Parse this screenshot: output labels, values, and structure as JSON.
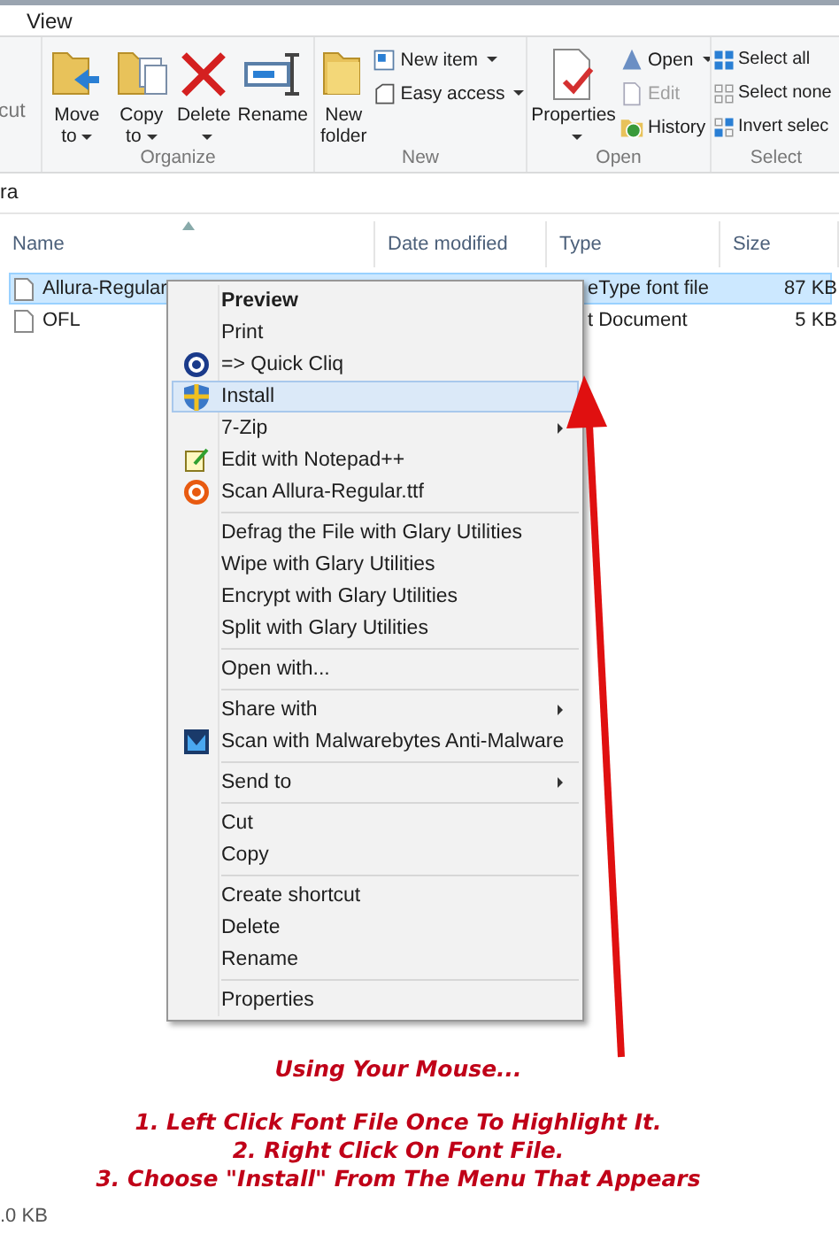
{
  "ribbon": {
    "tab": "View",
    "clipboard_fragment": "cut",
    "groups": [
      {
        "label": "Organize",
        "buttons": [
          {
            "kind": "large",
            "label": "Move to",
            "dropdown": true,
            "disabled": false
          },
          {
            "kind": "large",
            "label": "Copy to",
            "dropdown": true,
            "disabled": false
          },
          {
            "kind": "large",
            "label": "Delete",
            "dropdown": true,
            "disabled": false
          },
          {
            "kind": "large",
            "label": "Rename",
            "dropdown": false,
            "disabled": false
          }
        ]
      },
      {
        "label": "New",
        "buttons": [
          {
            "kind": "large",
            "label": "New folder",
            "dropdown": false,
            "disabled": false
          },
          {
            "kind": "small",
            "label": "New item",
            "dropdown": true,
            "disabled": false
          },
          {
            "kind": "small",
            "label": "Easy access",
            "dropdown": true,
            "disabled": false
          }
        ]
      },
      {
        "label": "Open",
        "buttons": [
          {
            "kind": "large",
            "label": "Properties",
            "dropdown": true,
            "disabled": false
          },
          {
            "kind": "small",
            "label": "Open",
            "dropdown": true,
            "disabled": false
          },
          {
            "kind": "small",
            "label": "Edit",
            "dropdown": false,
            "disabled": true
          },
          {
            "kind": "small",
            "label": "History",
            "dropdown": false,
            "disabled": false
          }
        ]
      },
      {
        "label": "Select",
        "buttons": [
          {
            "kind": "small",
            "label": "Select all",
            "dropdown": false,
            "disabled": false
          },
          {
            "kind": "small",
            "label": "Select none",
            "dropdown": false,
            "disabled": false
          },
          {
            "kind": "small",
            "label": "Invert selec",
            "dropdown": false,
            "disabled": false
          }
        ]
      }
    ]
  },
  "address": "ra",
  "table": {
    "columns": [
      "Name",
      "Date modified",
      "Type",
      "Size"
    ],
    "rows": [
      {
        "name": "Allura-Regular",
        "type": "eType font file",
        "size": "87 KB",
        "selected": true
      },
      {
        "name": "OFL",
        "type": "t Document",
        "size": "5 KB",
        "selected": false
      }
    ]
  },
  "context_menu": {
    "sections": [
      [
        {
          "label": "Preview",
          "bold": true,
          "submenu": false,
          "selected": false
        },
        {
          "label": "Print",
          "bold": false,
          "submenu": false,
          "selected": false
        },
        {
          "label": "=> Quick Cliq",
          "bold": false,
          "submenu": false,
          "selected": false
        },
        {
          "label": "Install",
          "bold": false,
          "submenu": false,
          "selected": true
        },
        {
          "label": "7-Zip",
          "bold": false,
          "submenu": true,
          "selected": false
        },
        {
          "label": "Edit with Notepad++",
          "bold": false,
          "submenu": false,
          "selected": false
        },
        {
          "label": "Scan Allura-Regular.ttf",
          "bold": false,
          "submenu": false,
          "selected": false
        }
      ],
      [
        {
          "label": "Defrag the File with Glary Utilities",
          "bold": false,
          "submenu": false,
          "selected": false
        },
        {
          "label": "Wipe with Glary Utilities",
          "bold": false,
          "submenu": false,
          "selected": false
        },
        {
          "label": "Encrypt with Glary Utilities",
          "bold": false,
          "submenu": false,
          "selected": false
        },
        {
          "label": "Split with Glary Utilities",
          "bold": false,
          "submenu": false,
          "selected": false
        }
      ],
      [
        {
          "label": "Open with...",
          "bold": false,
          "submenu": false,
          "selected": false
        }
      ],
      [
        {
          "label": "Share with",
          "bold": false,
          "submenu": true,
          "selected": false
        },
        {
          "label": "Scan with Malwarebytes Anti-Malware",
          "bold": false,
          "submenu": false,
          "selected": false
        }
      ],
      [
        {
          "label": "Send to",
          "bold": false,
          "submenu": true,
          "selected": false
        }
      ],
      [
        {
          "label": "Cut",
          "bold": false,
          "submenu": false,
          "selected": false
        },
        {
          "label": "Copy",
          "bold": false,
          "submenu": false,
          "selected": false
        }
      ],
      [
        {
          "label": "Create shortcut",
          "bold": false,
          "submenu": false,
          "selected": false
        },
        {
          "label": "Delete",
          "bold": false,
          "submenu": false,
          "selected": false
        },
        {
          "label": "Rename",
          "bold": false,
          "submenu": false,
          "selected": false
        }
      ],
      [
        {
          "label": "Properties",
          "bold": false,
          "submenu": false,
          "selected": false
        }
      ]
    ]
  },
  "annotation": {
    "title": "Using Your Mouse...",
    "steps": [
      "1. Left Click Font File Once To Highlight It.",
      "2. Right Click On Font File.",
      "3. Choose \"Install\" From The Menu That Appears"
    ]
  },
  "status_bar": ".0 KB"
}
